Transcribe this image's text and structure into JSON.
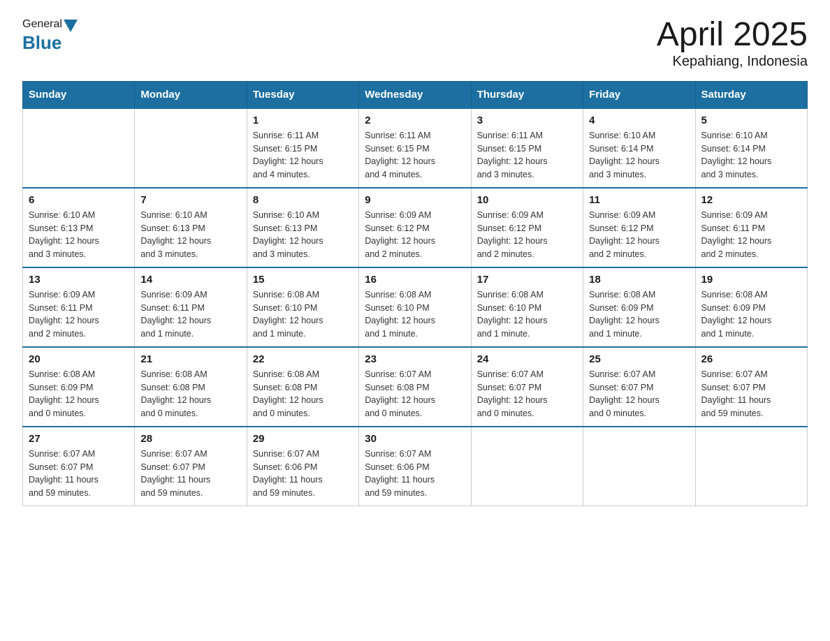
{
  "logo": {
    "general": "General",
    "blue": "Blue"
  },
  "title": "April 2025",
  "subtitle": "Kepahiang, Indonesia",
  "days": [
    "Sunday",
    "Monday",
    "Tuesday",
    "Wednesday",
    "Thursday",
    "Friday",
    "Saturday"
  ],
  "weeks": [
    [
      {
        "num": "",
        "info": ""
      },
      {
        "num": "",
        "info": ""
      },
      {
        "num": "1",
        "info": "Sunrise: 6:11 AM\nSunset: 6:15 PM\nDaylight: 12 hours\nand 4 minutes."
      },
      {
        "num": "2",
        "info": "Sunrise: 6:11 AM\nSunset: 6:15 PM\nDaylight: 12 hours\nand 4 minutes."
      },
      {
        "num": "3",
        "info": "Sunrise: 6:11 AM\nSunset: 6:15 PM\nDaylight: 12 hours\nand 3 minutes."
      },
      {
        "num": "4",
        "info": "Sunrise: 6:10 AM\nSunset: 6:14 PM\nDaylight: 12 hours\nand 3 minutes."
      },
      {
        "num": "5",
        "info": "Sunrise: 6:10 AM\nSunset: 6:14 PM\nDaylight: 12 hours\nand 3 minutes."
      }
    ],
    [
      {
        "num": "6",
        "info": "Sunrise: 6:10 AM\nSunset: 6:13 PM\nDaylight: 12 hours\nand 3 minutes."
      },
      {
        "num": "7",
        "info": "Sunrise: 6:10 AM\nSunset: 6:13 PM\nDaylight: 12 hours\nand 3 minutes."
      },
      {
        "num": "8",
        "info": "Sunrise: 6:10 AM\nSunset: 6:13 PM\nDaylight: 12 hours\nand 3 minutes."
      },
      {
        "num": "9",
        "info": "Sunrise: 6:09 AM\nSunset: 6:12 PM\nDaylight: 12 hours\nand 2 minutes."
      },
      {
        "num": "10",
        "info": "Sunrise: 6:09 AM\nSunset: 6:12 PM\nDaylight: 12 hours\nand 2 minutes."
      },
      {
        "num": "11",
        "info": "Sunrise: 6:09 AM\nSunset: 6:12 PM\nDaylight: 12 hours\nand 2 minutes."
      },
      {
        "num": "12",
        "info": "Sunrise: 6:09 AM\nSunset: 6:11 PM\nDaylight: 12 hours\nand 2 minutes."
      }
    ],
    [
      {
        "num": "13",
        "info": "Sunrise: 6:09 AM\nSunset: 6:11 PM\nDaylight: 12 hours\nand 2 minutes."
      },
      {
        "num": "14",
        "info": "Sunrise: 6:09 AM\nSunset: 6:11 PM\nDaylight: 12 hours\nand 1 minute."
      },
      {
        "num": "15",
        "info": "Sunrise: 6:08 AM\nSunset: 6:10 PM\nDaylight: 12 hours\nand 1 minute."
      },
      {
        "num": "16",
        "info": "Sunrise: 6:08 AM\nSunset: 6:10 PM\nDaylight: 12 hours\nand 1 minute."
      },
      {
        "num": "17",
        "info": "Sunrise: 6:08 AM\nSunset: 6:10 PM\nDaylight: 12 hours\nand 1 minute."
      },
      {
        "num": "18",
        "info": "Sunrise: 6:08 AM\nSunset: 6:09 PM\nDaylight: 12 hours\nand 1 minute."
      },
      {
        "num": "19",
        "info": "Sunrise: 6:08 AM\nSunset: 6:09 PM\nDaylight: 12 hours\nand 1 minute."
      }
    ],
    [
      {
        "num": "20",
        "info": "Sunrise: 6:08 AM\nSunset: 6:09 PM\nDaylight: 12 hours\nand 0 minutes."
      },
      {
        "num": "21",
        "info": "Sunrise: 6:08 AM\nSunset: 6:08 PM\nDaylight: 12 hours\nand 0 minutes."
      },
      {
        "num": "22",
        "info": "Sunrise: 6:08 AM\nSunset: 6:08 PM\nDaylight: 12 hours\nand 0 minutes."
      },
      {
        "num": "23",
        "info": "Sunrise: 6:07 AM\nSunset: 6:08 PM\nDaylight: 12 hours\nand 0 minutes."
      },
      {
        "num": "24",
        "info": "Sunrise: 6:07 AM\nSunset: 6:07 PM\nDaylight: 12 hours\nand 0 minutes."
      },
      {
        "num": "25",
        "info": "Sunrise: 6:07 AM\nSunset: 6:07 PM\nDaylight: 12 hours\nand 0 minutes."
      },
      {
        "num": "26",
        "info": "Sunrise: 6:07 AM\nSunset: 6:07 PM\nDaylight: 11 hours\nand 59 minutes."
      }
    ],
    [
      {
        "num": "27",
        "info": "Sunrise: 6:07 AM\nSunset: 6:07 PM\nDaylight: 11 hours\nand 59 minutes."
      },
      {
        "num": "28",
        "info": "Sunrise: 6:07 AM\nSunset: 6:07 PM\nDaylight: 11 hours\nand 59 minutes."
      },
      {
        "num": "29",
        "info": "Sunrise: 6:07 AM\nSunset: 6:06 PM\nDaylight: 11 hours\nand 59 minutes."
      },
      {
        "num": "30",
        "info": "Sunrise: 6:07 AM\nSunset: 6:06 PM\nDaylight: 11 hours\nand 59 minutes."
      },
      {
        "num": "",
        "info": ""
      },
      {
        "num": "",
        "info": ""
      },
      {
        "num": "",
        "info": ""
      }
    ]
  ]
}
